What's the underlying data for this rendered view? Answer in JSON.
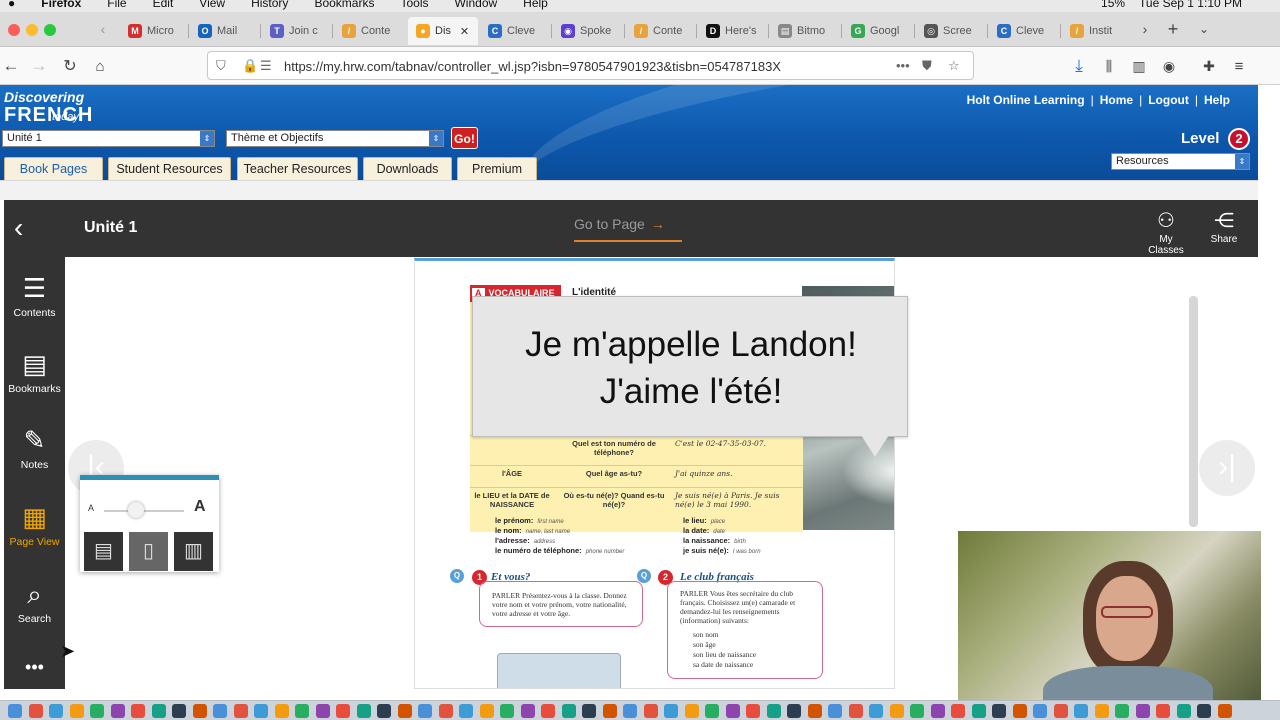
{
  "menubar": {
    "items": [
      "",
      "Firefox",
      "File",
      "Edit",
      "View",
      "History",
      "Bookmarks",
      "Tools",
      "Window",
      "Help"
    ],
    "battery": "15%",
    "clock": "Tue Sep 1  1:10 PM"
  },
  "tabs": [
    {
      "label": "Micro",
      "color": "#d32f2f",
      "glyph": "M"
    },
    {
      "label": "Mail",
      "color": "#1565c0",
      "glyph": "O"
    },
    {
      "label": "Join c",
      "color": "#5b5fc7",
      "glyph": "T"
    },
    {
      "label": "Conte",
      "color": "#e8a33c",
      "glyph": "/"
    },
    {
      "label": "Dis",
      "color": "#f5a623",
      "glyph": "●",
      "active": true
    },
    {
      "label": "Cleve",
      "color": "#2b6cc4",
      "glyph": "C"
    },
    {
      "label": "Spoke",
      "color": "#5d3fd3",
      "glyph": "◉"
    },
    {
      "label": "Conte",
      "color": "#e8a33c",
      "glyph": "/"
    },
    {
      "label": "Here's",
      "color": "#111111",
      "glyph": "D"
    },
    {
      "label": "Bitmo",
      "color": "#888888",
      "glyph": "▤"
    },
    {
      "label": "Googl",
      "color": "#34a853",
      "glyph": "G"
    },
    {
      "label": "Scree",
      "color": "#555555",
      "glyph": "◎"
    },
    {
      "label": "Cleve",
      "color": "#2b6cc4",
      "glyph": "C"
    },
    {
      "label": "Instit",
      "color": "#e8a33c",
      "glyph": "/"
    }
  ],
  "nav": {
    "url": "https://my.hrw.com/tabnav/controller_wl.jsp?isbn=9780547901923&tisbn=054787183X"
  },
  "hrw": {
    "logo_line1": "Discovering",
    "logo_line2": "FRENCH",
    "logo_line3": "today!",
    "unit_select": "Unité 1",
    "theme_select": "Thème et Objectifs",
    "go_label": "Go!",
    "links": [
      "Holt Online Learning",
      "Home",
      "Logout",
      "Help"
    ],
    "level_label": "Level",
    "level_value": "2",
    "resources_select": "Resources",
    "tabs": [
      "Book Pages",
      "Student Resources",
      "Teacher Resources",
      "Downloads",
      "Premium"
    ]
  },
  "reader": {
    "unit_title": "Unité 1",
    "goto_label": "Go to Page",
    "my_classes": "My Classes",
    "share": "Share",
    "side": [
      "Contents",
      "Bookmarks",
      "Notes",
      "Page View",
      "Search"
    ]
  },
  "page": {
    "vocab_tag_letter": "A",
    "vocab_tag": "VOCABULAIRE",
    "vocab_title": "L'identité",
    "rows": [
      {
        "c1": "",
        "c2": "Quel est ton numéro de téléphone?",
        "c3": "C'est le 02-47-35-03-07."
      },
      {
        "c1": "l'ÂGE",
        "c2": "Quel âge as-tu?",
        "c3": "J'ai quinze ans."
      },
      {
        "c1": "le LIEU et la DATE de NAISSANCE",
        "c2": "Où es-tu né(e)? Quand es-tu né(e)?",
        "c3": "Je suis né(e) à Paris. Je suis né(e) le 3 mai 1990."
      }
    ],
    "glossary_left": [
      {
        "fr": "le prénom:",
        "en": "first name"
      },
      {
        "fr": "le nom:",
        "en": "name, last name"
      },
      {
        "fr": "l'adresse:",
        "en": "address"
      },
      {
        "fr": "le numéro de téléphone:",
        "en": "phone number"
      }
    ],
    "glossary_right": [
      {
        "fr": "le lieu:",
        "en": "place"
      },
      {
        "fr": "la date:",
        "en": "date"
      },
      {
        "fr": "la naissance:",
        "en": "birth"
      },
      {
        "fr": "je suis né(e):",
        "en": "I was born"
      }
    ],
    "act1_num": "1",
    "act1_title": "Et vous?",
    "act1_text": "PARLER  Présentez-vous à la classe. Donnez votre nom et votre prénom, votre nationalité, votre adresse et votre âge.",
    "act2_num": "2",
    "act2_title": "Le club français",
    "act2_text": "PARLER  Vous êtes secrétaire du club français. Choisissez un(e) camarade et demandez-lui les renseignements (information) suivants:",
    "act2_bullets": [
      "son nom",
      "son âge",
      "son lieu de naissance",
      "sa date de naissance"
    ],
    "q_label": "Q"
  },
  "bubble": {
    "line1": "Je m'appelle Landon!",
    "line2": "J'aime l'été!"
  },
  "icons": {
    "back": "chevron-left-icon",
    "forward": "chevron-right-icon"
  }
}
